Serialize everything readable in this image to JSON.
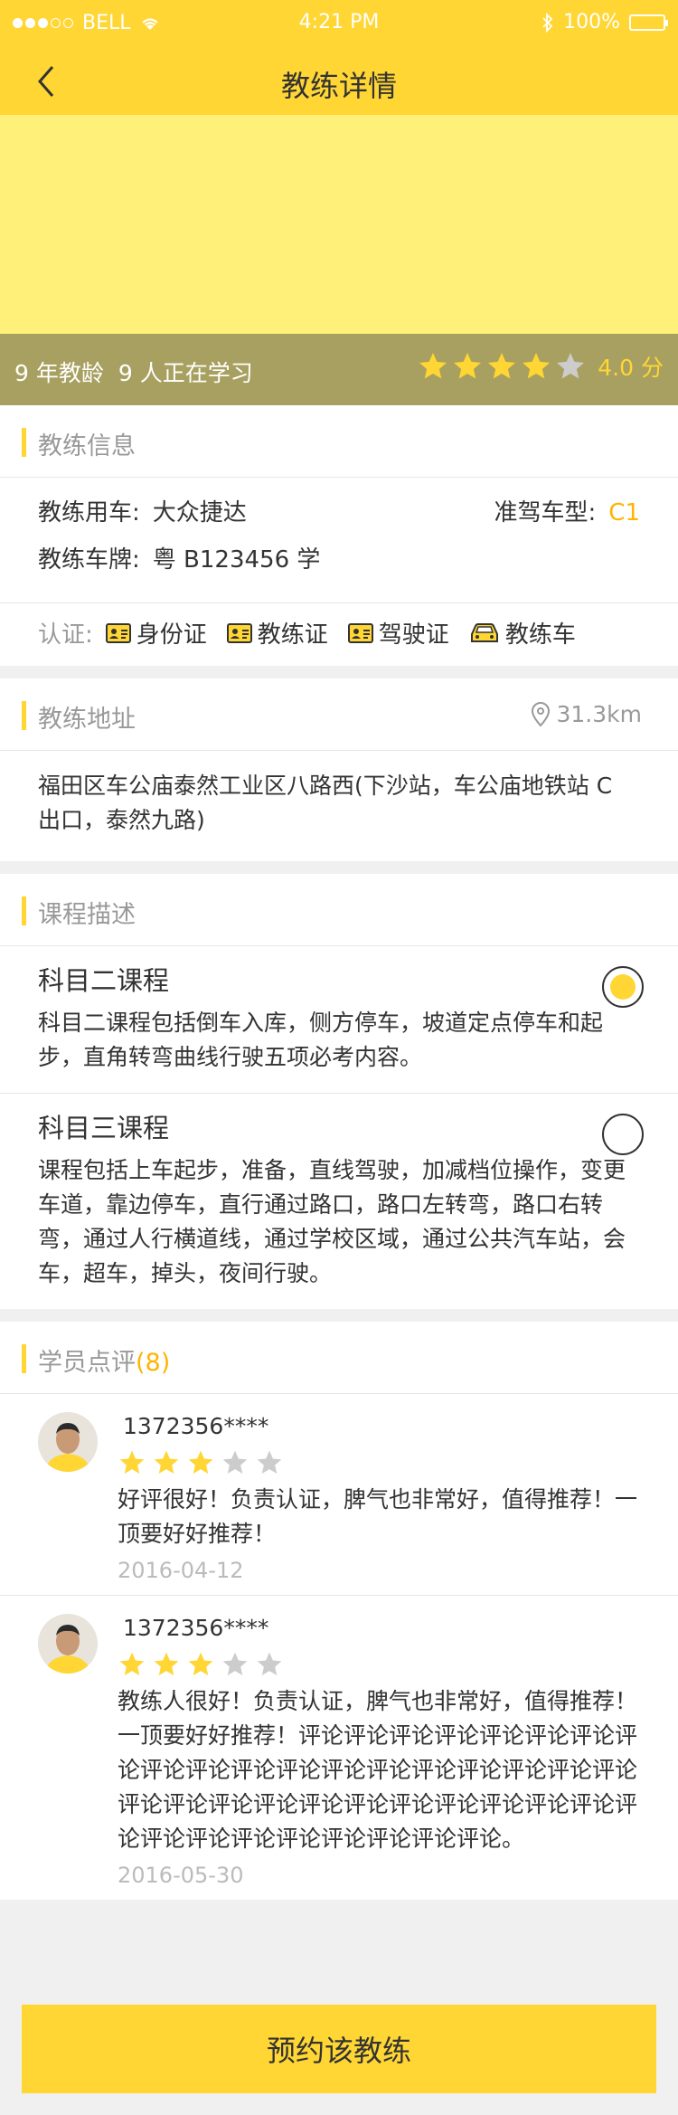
{
  "status": {
    "carrier": "BELL",
    "time": "4:21 PM",
    "battery": "100%"
  },
  "nav": {
    "title": "教练详情"
  },
  "hero": {
    "years": "9 年教龄",
    "learners": "9 人正在学习",
    "score": "4.0 分",
    "rating": 4
  },
  "colors": {
    "accent": "#ffd633",
    "hero_bg": "#fff07a",
    "hero_bar": "#a8a060"
  },
  "info": {
    "heading": "教练信息",
    "car_label": "教练用车:",
    "car_value": "大众捷达",
    "license_type_label": "准驾车型:",
    "license_type_value": "C1",
    "plate_label": "教练车牌:",
    "plate_value": "粤 B123456 学",
    "cert_label": "认证:",
    "certs": [
      "身份证",
      "教练证",
      "驾驶证",
      "教练车"
    ]
  },
  "address": {
    "heading": "教练地址",
    "distance": "31.3km",
    "text": "福田区车公庙泰然工业区八路西(下沙站，车公庙地铁站 C 出口，泰然九路)"
  },
  "courses": {
    "heading": "课程描述",
    "items": [
      {
        "title": "科目二课程",
        "desc": "科目二课程包括倒车入库，侧方停车，坡道定点停车和起步，直角转弯曲线行驶五项必考内容。",
        "selected": true
      },
      {
        "title": "科目三课程",
        "desc": "课程包括上车起步，准备，直线驾驶，加减档位操作，变更车道，靠边停车，直行通过路口，路口左转弯，路口右转弯，通过人行横道线，通过学校区域，通过公共汽车站，会车，超车，掉头，夜间行驶。",
        "selected": false
      }
    ]
  },
  "reviews": {
    "heading": "学员点评",
    "count": "(8)",
    "items": [
      {
        "user": "1372356****",
        "rating": 3,
        "text": "好评很好！负责认证，脾气也非常好，值得推荐！一顶要好好推荐！",
        "date": "2016-04-12"
      },
      {
        "user": "1372356****",
        "rating": 3,
        "text": "教练人很好！负责认证，脾气也非常好，值得推荐！一顶要好好推荐！评论评论评论评论评论评论评论评论评论评论评论评论评论评论评论评论评论评论评论评论评论评论评论评论评论评论评论评论评论评论评论评论评论评论评论评论评论评论评论。",
        "date": "2016-05-30"
      }
    ]
  },
  "footer": {
    "book_label": "预约该教练"
  }
}
